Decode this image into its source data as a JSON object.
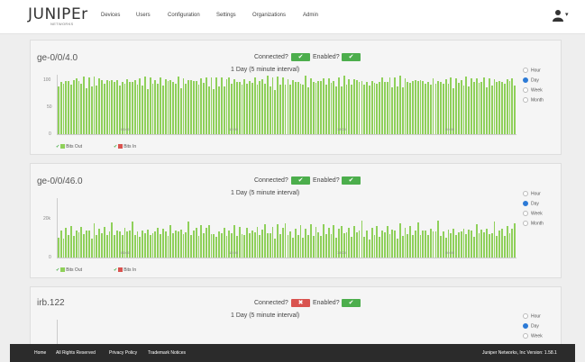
{
  "brand": {
    "logo": "JUNIPEr",
    "sub": "NETWORKS"
  },
  "nav": [
    "Devices",
    "Users",
    "Configuration",
    "Settings",
    "Organizations",
    "Admin"
  ],
  "user_caret": "▾",
  "panels": [
    {
      "name": "ge-0/0/4.0",
      "connected_label": "Connected?",
      "connected": "✔",
      "enabled_label": "Enabled?",
      "enabled": "✔",
      "chart_title": "1 Day (5 minute interval)",
      "y_ticks": [
        "100",
        "50",
        "0"
      ],
      "x_ticks": [
        "06:00",
        "12:00",
        "18:00",
        "00:00"
      ],
      "legend": [
        {
          "label": "Bits Out",
          "color": "#8fd05a"
        },
        {
          "label": "Bits In",
          "color": "#d9534f"
        }
      ],
      "range": [
        "Hour",
        "Day",
        "Week",
        "Month"
      ],
      "selected_range": "Day"
    },
    {
      "name": "ge-0/0/46.0",
      "connected_label": "Connected?",
      "connected": "✔",
      "enabled_label": "Enabled?",
      "enabled": "✔",
      "chart_title": "1 Day (5 minute interval)",
      "y_ticks": [
        "20k",
        "0"
      ],
      "x_ticks": [
        "06:00",
        "12:00",
        "18:00",
        "00:00"
      ],
      "legend": [
        {
          "label": "Bits Out",
          "color": "#8fd05a"
        },
        {
          "label": "Bits In",
          "color": "#d9534f"
        }
      ],
      "range": [
        "Hour",
        "Day",
        "Week",
        "Month"
      ],
      "selected_range": "Day"
    },
    {
      "name": "irb.122",
      "connected_label": "Connected?",
      "connected": "✖",
      "enabled_label": "Enabled?",
      "enabled": "✔",
      "chart_title": "1 Day (5 minute interval)",
      "range": [
        "Hour",
        "Day",
        "Week"
      ],
      "selected_range": "Day"
    }
  ],
  "chart_data": [
    {
      "type": "bar",
      "title": "1 Day (5 minute interval)",
      "ylim": [
        0,
        100
      ],
      "series": [
        {
          "name": "Bits Out",
          "values": [
            95,
            88,
            96,
            90,
            97,
            86,
            95,
            99,
            91,
            94,
            97,
            88,
            96,
            93,
            98,
            90,
            95,
            97,
            89,
            94,
            96,
            92,
            99,
            91,
            95,
            88,
            97,
            94,
            96,
            90
          ]
        }
      ]
    },
    {
      "type": "bar",
      "title": "1 Day (5 minute interval)",
      "series": [
        {
          "name": "Bits Out",
          "values": [
            19,
            22,
            17,
            24,
            20,
            26,
            18,
            23,
            21,
            27,
            19,
            25,
            22,
            18,
            28,
            20,
            24,
            21,
            26,
            19,
            23,
            29,
            20,
            22,
            25,
            18,
            27,
            21,
            24,
            30
          ]
        }
      ]
    }
  ],
  "footer": {
    "links": [
      "Home",
      "All Rights Reserved",
      "Privacy Policy",
      "Trademark Notices"
    ],
    "version": "Juniper Networks, Inc Version: 1.58.1"
  }
}
